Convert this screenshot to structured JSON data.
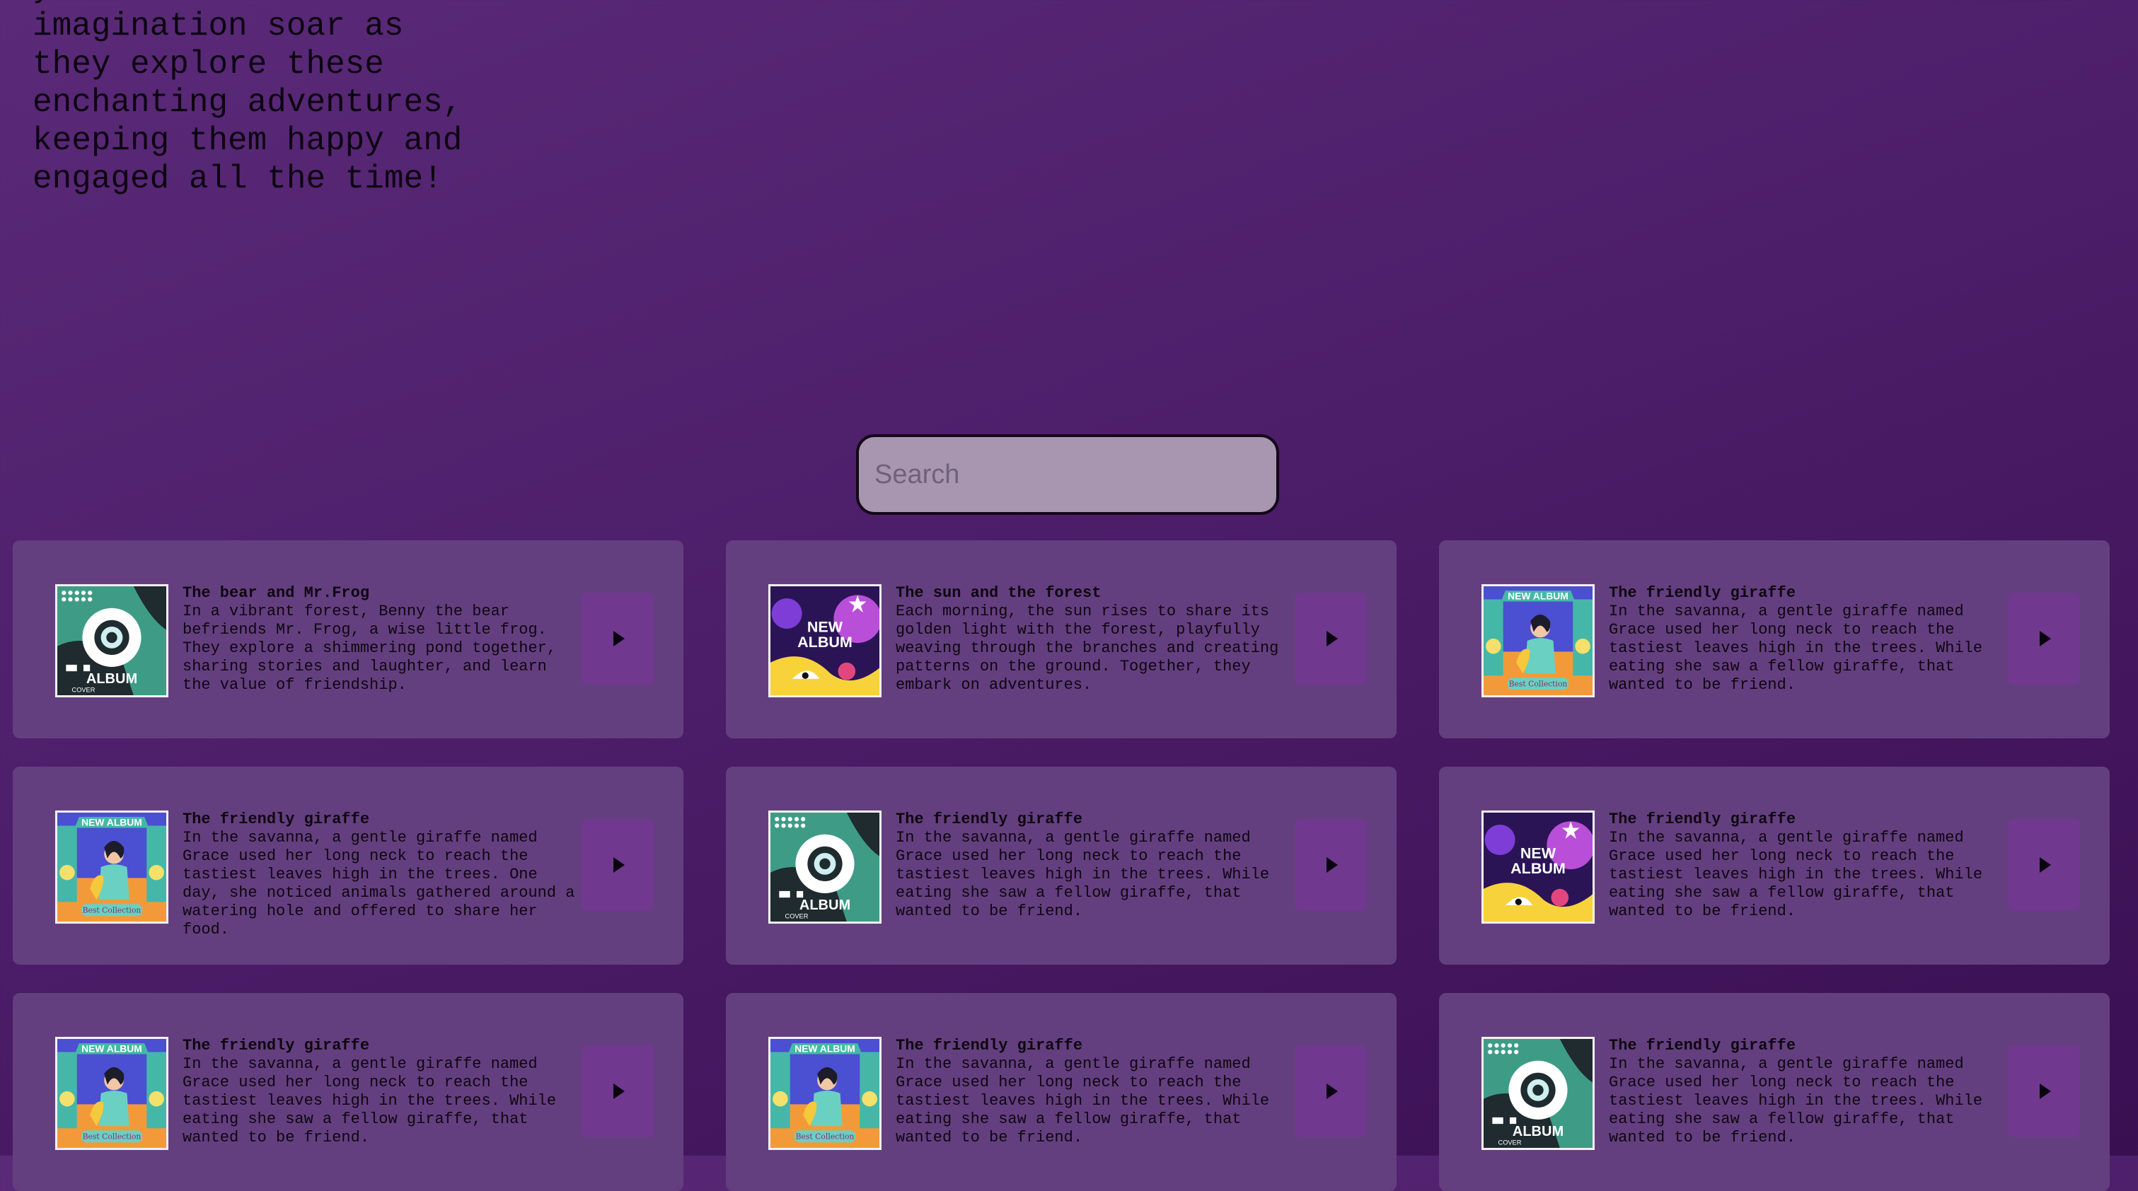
{
  "intro": {
    "text": "your child's imagination soar as they explore these enchanting adventures, keeping them happy and engaged all the time!"
  },
  "search": {
    "placeholder": "Search"
  },
  "stories": [
    {
      "title": "The bear and Mr.Frog",
      "description": "In a vibrant forest, Benny the bear befriends Mr. Frog, a wise little frog. They explore a shimmering pond together, sharing stories and laughter, and learn the value of friendship.",
      "cover": "album-cover-teal",
      "cover_text": [
        "ALBUM",
        "COVER"
      ]
    },
    {
      "title": "The sun and the forest",
      "description": "Each morning, the sun rises to share its golden light with the forest, playfully weaving through the branches and creating patterns on the ground. Together, they embark on adventures.",
      "cover": "new-album-purple",
      "cover_text": [
        "NEW",
        "ALBUM"
      ]
    },
    {
      "title": "The friendly giraffe",
      "description": "In the savanna, a gentle giraffe named Grace used her long neck to reach the tastiest leaves high in the trees. While eating she saw a fellow giraffe, that wanted to be friend.",
      "cover": "new-album-saxophone",
      "cover_text": [
        "NEW ALBUM",
        "Best Collection"
      ]
    },
    {
      "title": "The friendly giraffe",
      "description": "In the savanna, a gentle giraffe named Grace used her long neck to reach the tastiest leaves high in the trees. One day, she noticed animals gathered around a watering hole and offered to share her food.",
      "cover": "new-album-saxophone",
      "cover_text": [
        "NEW ALBUM",
        "Best Collection"
      ]
    },
    {
      "title": "The friendly giraffe",
      "description": "In the savanna, a gentle giraffe named Grace used her long neck to reach the tastiest leaves high in the trees. While eating she saw a fellow giraffe, that wanted to be friend.",
      "cover": "album-cover-teal",
      "cover_text": [
        "ALBUM",
        "COVER"
      ]
    },
    {
      "title": "The friendly giraffe",
      "description": "In the savanna, a gentle giraffe named Grace used her long neck to reach the tastiest leaves high in the trees. While eating she saw a fellow giraffe, that wanted to be friend.",
      "cover": "new-album-purple",
      "cover_text": [
        "NEW",
        "ALBUM"
      ]
    },
    {
      "title": "The friendly giraffe",
      "description": "In the savanna, a gentle giraffe named Grace used her long neck to reach the tastiest leaves high in the trees. While eating she saw a fellow giraffe, that wanted to be friend.",
      "cover": "new-album-saxophone",
      "cover_text": [
        "NEW ALBUM",
        "Best Collection"
      ]
    },
    {
      "title": "The friendly giraffe",
      "description": "In the savanna, a gentle giraffe named Grace used her long neck to reach the tastiest leaves high in the trees. While eating she saw a fellow giraffe, that wanted to be friend.",
      "cover": "new-album-saxophone",
      "cover_text": [
        "NEW ALBUM",
        "Best Collection"
      ]
    },
    {
      "title": "The friendly giraffe",
      "description": "In the savanna, a gentle giraffe named Grace used her long neck to reach the tastiest leaves high in the trees. While eating she saw a fellow giraffe, that wanted to be friend.",
      "cover": "album-cover-teal",
      "cover_text": [
        "ALBUM",
        "COVER"
      ]
    }
  ],
  "play_icon": "play-icon",
  "colors": {
    "background": "#4d1e6a",
    "card": "#643f7f",
    "play_button": "#70388f",
    "search_field": "#a896b0"
  }
}
